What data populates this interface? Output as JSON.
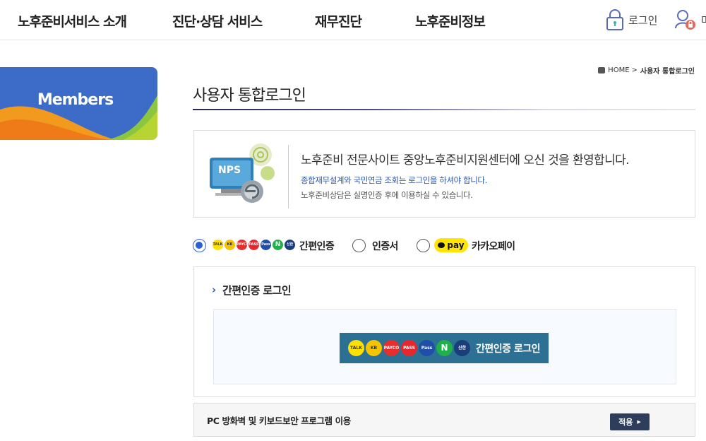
{
  "gnb": {
    "items": [
      "노후준비서비스 소개",
      "진단·상담 서비스",
      "재무진단",
      "노후준비정보"
    ],
    "login_label": "로그인",
    "member_label_partial": "마"
  },
  "lnb": {
    "title": "Members"
  },
  "breadcrumb": {
    "home": "HOME",
    "separator": ">",
    "current": "사용자 통합로그인"
  },
  "page": {
    "title": "사용자 통합로그인"
  },
  "welcome": {
    "logo_text": "NPS",
    "main": "노후준비 전문사이트 중앙노후준비지원센터에 오신 것을 환영합니다.",
    "notice_blue": "종합재무설계와 국민연금 조회는 로그인을 하셔야 합니다.",
    "notice_gray": "노후준비상담은 실명인증 후에 이용하실 수 있습니다."
  },
  "login_options": [
    {
      "label": "간편인증",
      "selected": true
    },
    {
      "label": "인증서",
      "selected": false
    },
    {
      "label": "카카오페이",
      "selected": false
    }
  ],
  "kakaopay_badge": "pay",
  "provider_icons": [
    {
      "name": "kakao",
      "text": "TALK",
      "color": "#ffe000"
    },
    {
      "name": "kb",
      "text": "KB",
      "color": "#f5c400"
    },
    {
      "name": "payco",
      "text": "PAYCO",
      "color": "#e82d2d"
    },
    {
      "name": "pass",
      "text": "PASS",
      "color": "#e8262d"
    },
    {
      "name": "samsung-pass",
      "text": "Pass",
      "color": "#1f4fa8"
    },
    {
      "name": "naver",
      "text": "N",
      "color": "#20b04b"
    },
    {
      "name": "shinhan",
      "text": "신한",
      "color": "#1b3d7a"
    }
  ],
  "simple_auth": {
    "section_title": "간편인증 로그인",
    "button_label": "간편인증 로그인"
  },
  "pc_security": {
    "label": "PC 방화벽 및 키보드보안 프로그램 이용",
    "apply_button": "적용"
  },
  "colors": {
    "primary_blue": "#2a62d6",
    "members_bg": "#3d6cc8",
    "button_teal": "#2c7194",
    "apply_navy": "#2e3d5c"
  }
}
